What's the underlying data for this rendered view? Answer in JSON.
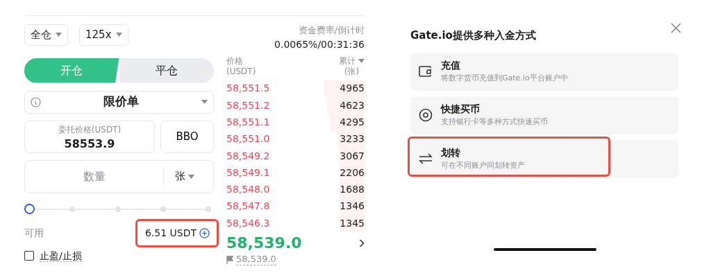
{
  "margin_mode": {
    "label": "全仓"
  },
  "leverage": {
    "label": "125x"
  },
  "position_tabs": [
    {
      "label": "开仓",
      "selected": true
    },
    {
      "label": "平仓",
      "selected": false
    }
  ],
  "order_type": {
    "label": "限价单"
  },
  "price_field": {
    "label": "委托价格(USDT)",
    "value": "58553.9"
  },
  "bbo_button": "BBO",
  "quantity_field": {
    "placeholder": "数量",
    "unit": "张"
  },
  "size_slider": {
    "level": 0
  },
  "available": {
    "label": "可用",
    "value": "6.51 USDT",
    "highlighted": true
  },
  "tp_sl": {
    "label": "止盈/止损",
    "checked": false
  },
  "funding": {
    "label": "资金费率/倒计时",
    "value": "0.0065%/00:31:36"
  },
  "order_book": {
    "price_header": [
      "价格",
      "(USDT)"
    ],
    "total_header": [
      "累计",
      "(张)"
    ],
    "rows": [
      {
        "price": "58,551.5",
        "total": "4965"
      },
      {
        "price": "58,551.2",
        "total": "4623"
      },
      {
        "price": "58,551.1",
        "total": "4295"
      },
      {
        "price": "58,551.0",
        "total": "3233"
      },
      {
        "price": "58,549.2",
        "total": "3067"
      },
      {
        "price": "58,549.1",
        "total": "2206"
      },
      {
        "price": "58,548.0",
        "total": "1688"
      },
      {
        "price": "58,547.8",
        "total": "1346"
      },
      {
        "price": "58,546.3",
        "total": "1345"
      }
    ],
    "last_price": "58,539.0",
    "mark_price": "58,539.0"
  },
  "deposit_sheet": {
    "title": "Gate.io提供多种入金方式",
    "options": [
      {
        "kind": "wallet",
        "title": "充值",
        "subtitle": "将数字货币充值到Gate.io平台账户中",
        "highlighted": false
      },
      {
        "kind": "coin",
        "title": "快捷买币",
        "subtitle": "支持银行卡等多种方式快速买币",
        "highlighted": false
      },
      {
        "kind": "transfer",
        "title": "划转",
        "subtitle": "可在不同账户间划转资产",
        "highlighted": true
      }
    ]
  }
}
